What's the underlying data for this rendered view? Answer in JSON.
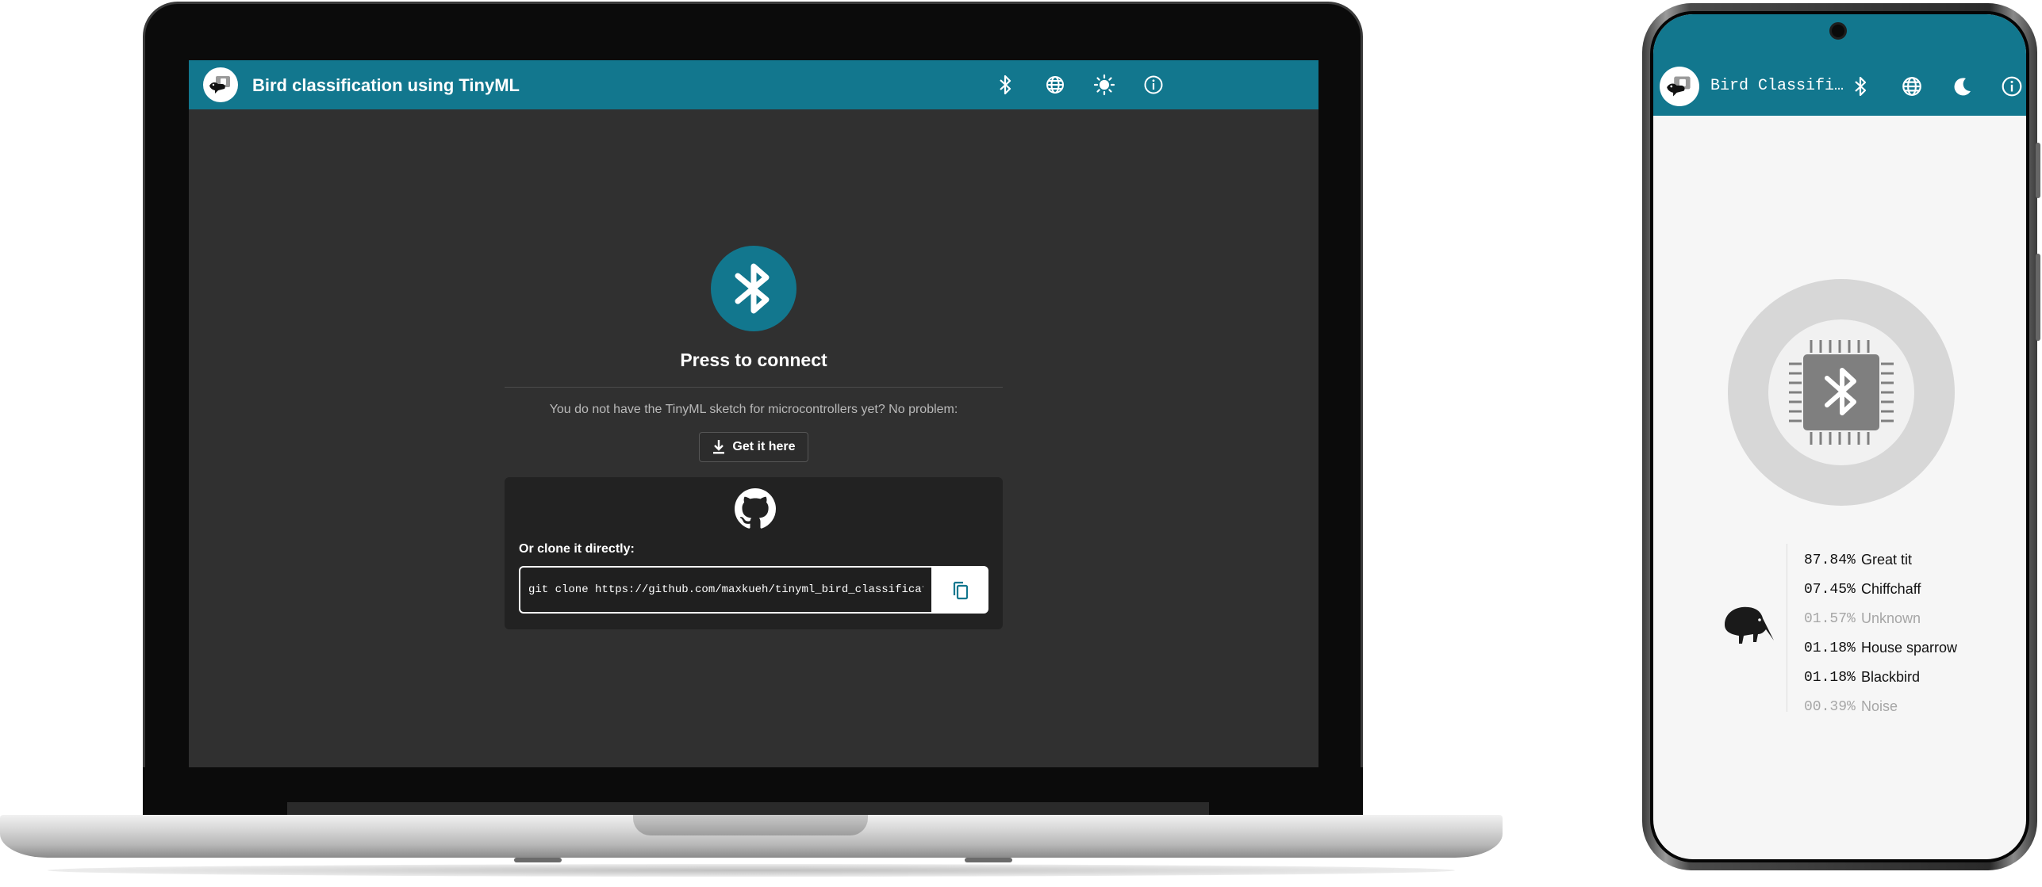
{
  "laptop": {
    "app": {
      "title": "Bird classification using TinyML",
      "accent": "#12778e",
      "background": "#303030",
      "header_icons": [
        "bluetooth-icon",
        "globe-icon",
        "sun-icon",
        "info-icon"
      ]
    },
    "connect": {
      "label": "Press to connect"
    },
    "sketch": {
      "message": "You do not have the TinyML sketch for microcontrollers yet? No problem:",
      "get_label": "Get it here"
    },
    "clone": {
      "label": "Or clone it directly:",
      "command": "git clone https://github.com/maxkueh/tinyml_bird_classification.git"
    }
  },
  "phone": {
    "app": {
      "title": "Bird Classifi…",
      "accent": "#12778e",
      "background": "#f6f6f6",
      "header_icons": [
        "bluetooth-icon",
        "globe-icon",
        "moon-icon",
        "info-icon"
      ]
    },
    "results": [
      {
        "percent": "87.84%",
        "name": "Great tit",
        "muted": false
      },
      {
        "percent": "07.45%",
        "name": "Chiffchaff",
        "muted": false
      },
      {
        "percent": "01.57%",
        "name": "Unknown",
        "muted": true
      },
      {
        "percent": "01.18%",
        "name": "House sparrow",
        "muted": false
      },
      {
        "percent": "01.18%",
        "name": "Blackbird",
        "muted": false
      },
      {
        "percent": "00.39%",
        "name": "Noise",
        "muted": true
      }
    ]
  }
}
